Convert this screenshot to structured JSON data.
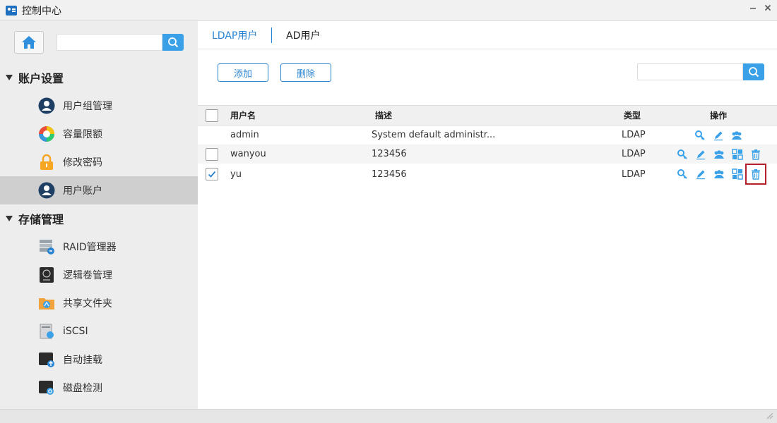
{
  "window": {
    "title": "控制中心"
  },
  "sidebar": {
    "sections": [
      {
        "label": "账户设置"
      },
      {
        "label": "存储管理"
      }
    ],
    "items": [
      {
        "label": "用户组管理"
      },
      {
        "label": "容量限额"
      },
      {
        "label": "修改密码"
      },
      {
        "label": "用户账户"
      },
      {
        "label": "RAID管理器"
      },
      {
        "label": "逻辑卷管理"
      },
      {
        "label": "共享文件夹"
      },
      {
        "label": "iSCSI"
      },
      {
        "label": "自动挂载"
      },
      {
        "label": "磁盘检测"
      }
    ],
    "active_item": "用户账户"
  },
  "tabs": [
    {
      "label": "LDAP用户",
      "active": true
    },
    {
      "label": "AD用户",
      "active": false
    }
  ],
  "toolbar": {
    "add_label": "添加",
    "delete_label": "删除"
  },
  "table": {
    "columns": [
      "用户名",
      "描述",
      "类型",
      "操作"
    ],
    "rows": [
      {
        "name": "admin",
        "desc": "System default administr...",
        "type": "LDAP",
        "checkbox": "none",
        "ops": [
          "key-icon",
          "edit-icon",
          "group-icon"
        ]
      },
      {
        "name": "wanyou",
        "desc": "123456",
        "type": "LDAP",
        "checkbox": "unchecked",
        "ops": [
          "key-icon",
          "edit-icon",
          "group-icon",
          "apps-icon",
          "trash-icon"
        ]
      },
      {
        "name": "yu",
        "desc": "123456",
        "type": "LDAP",
        "checkbox": "checked",
        "ops": [
          "key-icon",
          "edit-icon",
          "group-icon",
          "apps-icon",
          "trash-icon"
        ]
      }
    ]
  },
  "colors": {
    "accent": "#2a84d1",
    "search_button": "#3aa1e8",
    "highlight": "#b3202a"
  }
}
